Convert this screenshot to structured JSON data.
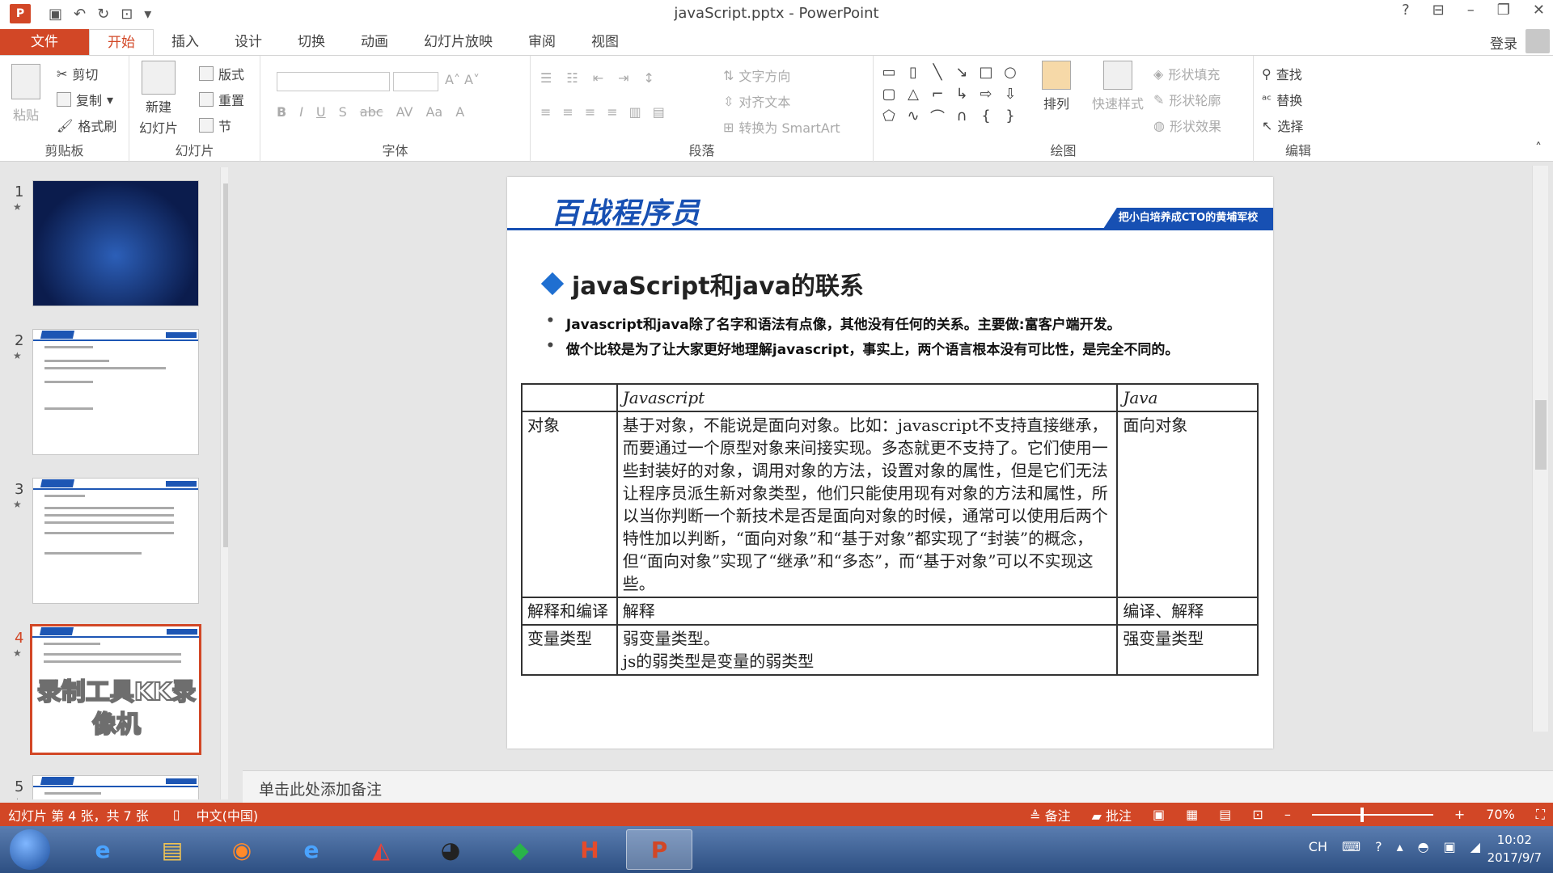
{
  "window": {
    "title": "javaScript.pptx - PowerPoint",
    "help": "?",
    "login": "登录"
  },
  "tabs": [
    "文件",
    "开始",
    "插入",
    "设计",
    "切换",
    "动画",
    "幻灯片放映",
    "审阅",
    "视图"
  ],
  "ribbon": {
    "clipboard": {
      "paste": "粘贴",
      "cut": "剪切",
      "copy": "复制",
      "format_painter": "格式刷",
      "label": "剪贴板"
    },
    "slides": {
      "new_slide": "新建",
      "new_slide2": "幻灯片",
      "layout": "版式",
      "reset": "重置",
      "section": "节",
      "label": "幻灯片"
    },
    "font": {
      "label": "字体"
    },
    "paragraph": {
      "text_direction": "文字方向",
      "align_text": "对齐文本",
      "smartart": "转换为 SmartArt",
      "label": "段落"
    },
    "drawing": {
      "arrange": "排列",
      "quick_styles": "快速样式",
      "shape_fill": "形状填充",
      "shape_outline": "形状轮廓",
      "shape_effects": "形状效果",
      "label": "绘图"
    },
    "editing": {
      "find": "查找",
      "replace": "替换",
      "select": "选择",
      "label": "编辑"
    }
  },
  "thumbnails": [
    {
      "num": "1"
    },
    {
      "num": "2"
    },
    {
      "num": "3"
    },
    {
      "num": "4",
      "watermark": "录制工具KK录像机"
    },
    {
      "num": "5"
    }
  ],
  "slide": {
    "brand": "百战程序员",
    "tagline": "把小白培养成CTO的黄埔军校",
    "title": "javaScript和java的联系",
    "bullets": [
      "Javascript和java除了名字和语法有点像，其他没有任何的关系。主要做:富客户端开发。",
      "做个比较是为了让大家更好地理解javascript，事实上，两个语言根本没有可比性，是完全不同的。"
    ],
    "table": {
      "headers": [
        "",
        "Javascript",
        "Java"
      ],
      "rows": [
        [
          "对象",
          "基于对象，不能说是面向对象。比如：javascript不支持直接继承，而要通过一个原型对象来间接实现。多态就更不支持了。它们使用一些封装好的对象，调用对象的方法，设置对象的属性，但是它们无法让程序员派生新对象类型，他们只能使用现有对象的方法和属性，所以当你判断一个新技术是否是面向对象的时候，通常可以使用后两个特性加以判断，“面向对象”和“基于对象”都实现了“封装”的概念，但“面向对象”实现了“继承”和“多态”，而“基于对象”可以不实现这些。",
          "面向对象"
        ],
        [
          "解释和编译",
          "解释",
          "编译、解释"
        ],
        [
          "变量类型",
          "弱变量类型。\njs的弱类型是变量的弱类型",
          "强变量类型"
        ]
      ]
    }
  },
  "notes": {
    "placeholder": "单击此处添加备注"
  },
  "status": {
    "slide_info": "幻灯片 第 4 张，共 7 张",
    "language": "中文(中国)",
    "notes_btn": "备注",
    "comments_btn": "批注",
    "zoom": "70%"
  },
  "taskbar": {
    "time": "10:02",
    "date": "2017/9/7",
    "ime": "CH"
  }
}
